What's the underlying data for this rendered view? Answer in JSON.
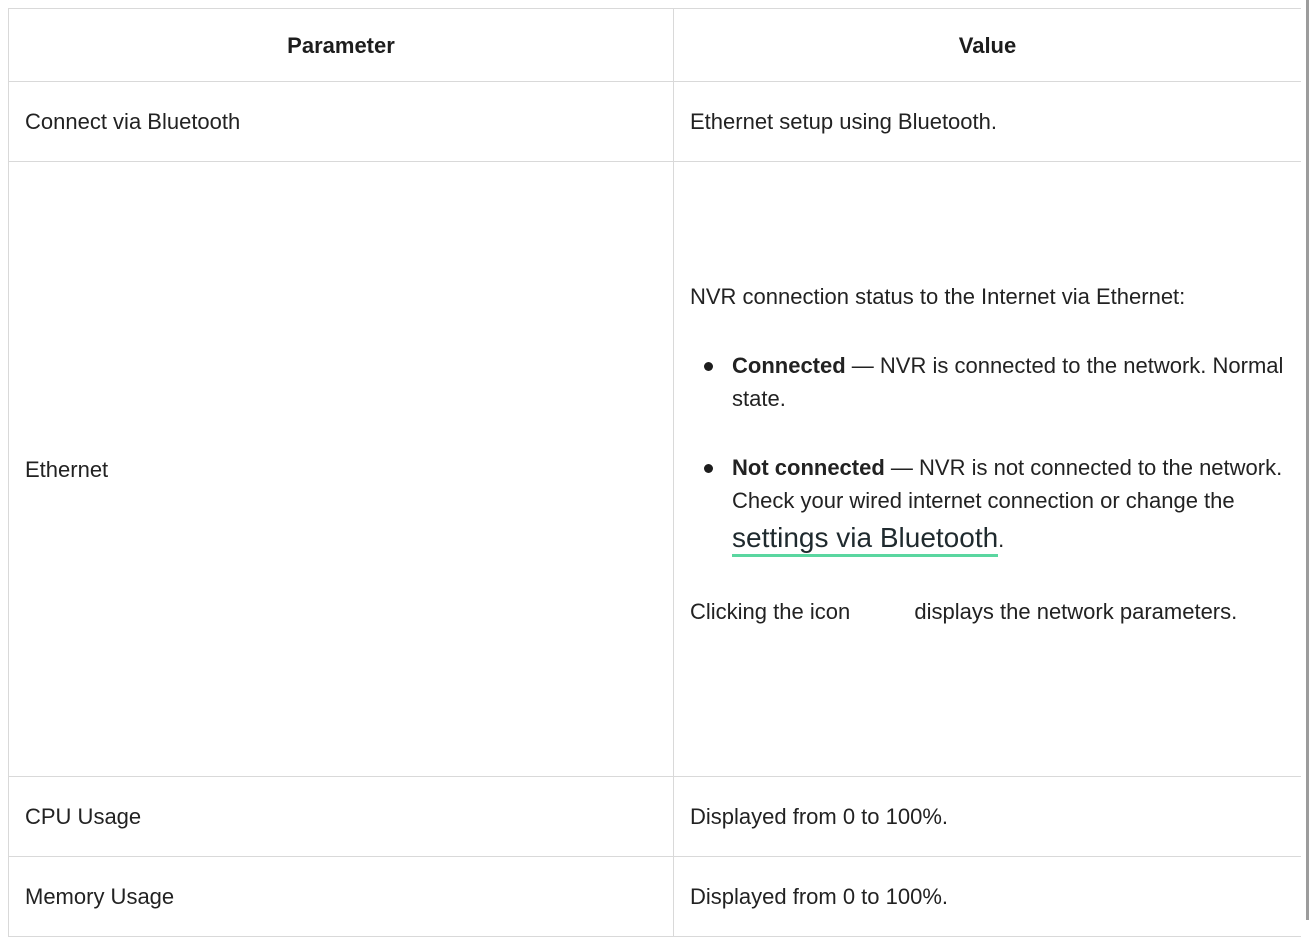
{
  "table": {
    "headers": {
      "parameter": "Parameter",
      "value": "Value"
    },
    "rows": {
      "bluetooth": {
        "parameter": "Connect via Bluetooth",
        "value": "Ethernet setup using Bluetooth."
      },
      "ethernet": {
        "parameter": "Ethernet",
        "intro": "NVR connection status to the Internet via Ethernet:",
        "connected_label": "Connected",
        "connected_text": " — NVR is connected to the network. Normal state.",
        "not_connected_label": "Not connected",
        "not_connected_text": " — NVR is not connected to the network. Check your wired internet connection or change the ",
        "settings_link": "settings via Bluetooth",
        "after_link": ".",
        "click_before_icon": "Clicking the icon ",
        "click_after_icon": " displays the network parameters."
      },
      "cpu": {
        "parameter": "CPU Usage",
        "value": "Displayed from 0 to 100%."
      },
      "memory": {
        "parameter": "Memory Usage",
        "value": "Displayed from 0 to 100%."
      }
    }
  }
}
